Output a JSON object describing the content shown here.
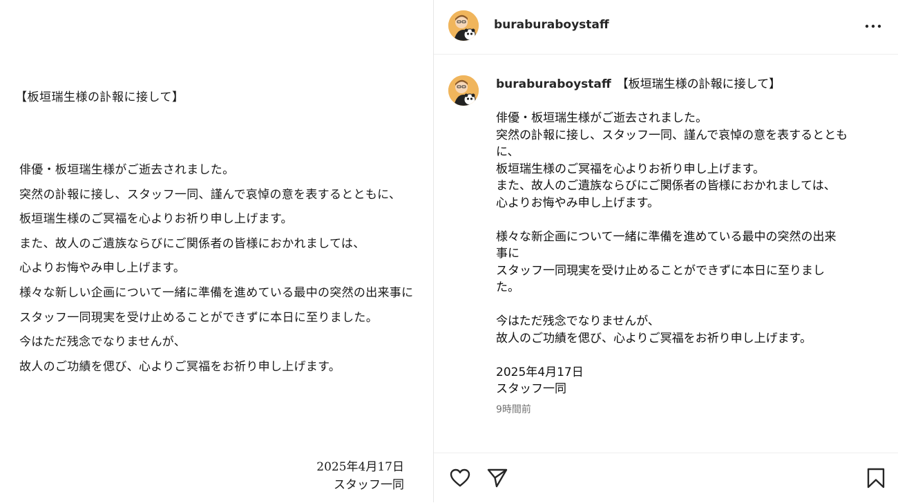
{
  "post_image": {
    "title": "【板垣瑞生様の訃報に接して】",
    "lines": [
      "俳優・板垣瑞生様がご逝去されました。",
      "突然の訃報に接し、スタッフ一同、謹んで哀悼の意を表するとともに、",
      "板垣瑞生様のご冥福を心よりお祈り申し上げます。",
      "また、故人のご遺族ならびにご関係者の皆様におかれましては、",
      "心よりお悔やみ申し上げます。",
      "様々な新しい企画について一緒に準備を進めている最中の突然の出来事に",
      "スタッフ一同現実を受け止めることができずに本日に至りました。",
      "今はただ残念でなりませんが、",
      "故人のご功績を偲び、心よりご冥福をお祈り申し上げます。"
    ],
    "date": "2025年4月17日",
    "signature": "スタッフ一同"
  },
  "header": {
    "username": "buraburaboystaff",
    "avatar_icon": "avatar-cartoon-panda",
    "more_icon": "more-horizontal-icon"
  },
  "caption": {
    "username": "buraburaboystaff",
    "title": "【板垣瑞生様の訃報に接して】",
    "paragraphs": [
      [
        "俳優・板垣瑞生様がご逝去されました。",
        "突然の訃報に接し、スタッフ一同、謹んで哀悼の意を表するととも",
        "に、",
        "板垣瑞生様のご冥福を心よりお祈り申し上げます。",
        "また、故人のご遺族ならびにご関係者の皆様におかれましては、",
        "心よりお悔やみ申し上げます。"
      ],
      [
        "様々な新企画について一緒に準備を進めている最中の突然の出来",
        "事に",
        "スタッフ一同現実を受け止めることができずに本日に至りまし",
        "た。"
      ],
      [
        "今はただ残念でなりませんが、",
        "故人のご功績を偲び、心よりご冥福をお祈り申し上げます。"
      ],
      [
        "2025年4月17日",
        "スタッフ一同"
      ]
    ],
    "timestamp": "9時間前"
  },
  "actions": {
    "like_icon": "heart-icon",
    "share_icon": "send-icon",
    "save_icon": "bookmark-icon"
  },
  "colors": {
    "text": "#111111",
    "muted": "#737373",
    "divider": "#efefef",
    "avatar_bg": "#f0b55c"
  }
}
